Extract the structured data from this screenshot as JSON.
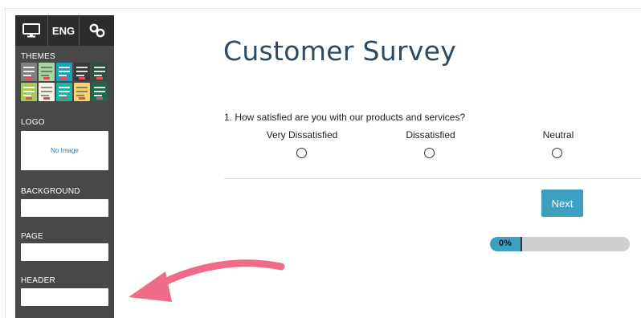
{
  "sidebar": {
    "toolbar": {
      "desktop_icon": "desktop-monitor-icon",
      "language": "ENG",
      "link_icon": "link-chain-icon"
    },
    "themes_label": "THEMES",
    "theme_swatch_colors": [
      "#7e7e7e",
      "#a8d4a0",
      "#1aa1b8",
      "#3a3a3a",
      "#2d4f3f",
      "#a6c85b",
      "#f7f3e5",
      "#1ab6a4",
      "#f7d36d",
      "#1a6a49"
    ],
    "logo_label": "LOGO",
    "logo_placeholder": "No Image",
    "background_label": "BACKGROUND",
    "page_label": "PAGE",
    "header_label": "HEADER"
  },
  "survey": {
    "title": "Customer Survey",
    "question": "1. How satisfied are you with our products and services?",
    "choices": [
      "Very Dissatisfied",
      "Dissatisfied",
      "Neutral"
    ],
    "next_label": "Next",
    "progress_text": "0%",
    "progress_value": 0
  },
  "colors": {
    "accent": "#3ea0c1",
    "title": "#2f4a60",
    "sidebar_bg": "#484848",
    "arrow": "#ee6b8a"
  }
}
